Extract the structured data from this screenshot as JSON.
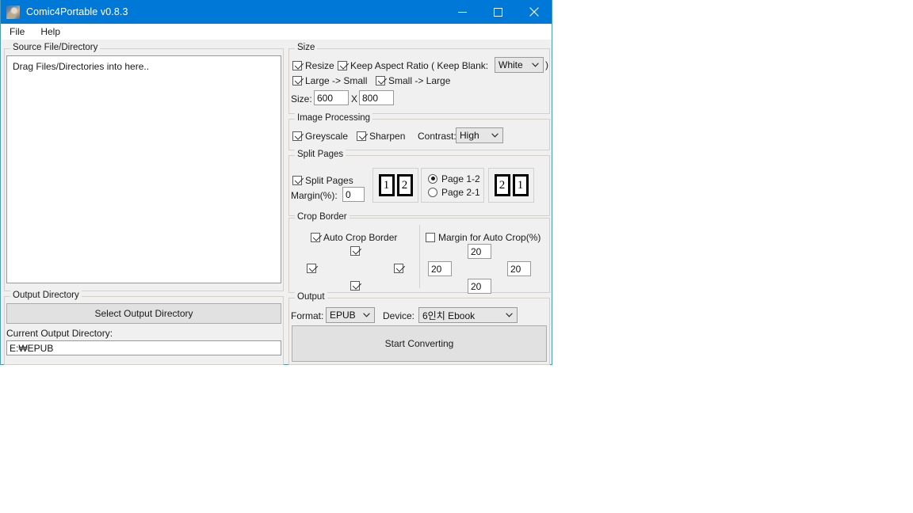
{
  "window": {
    "title": "Comic4Portable v0.8.3",
    "icon": "app-portrait-icon",
    "accent": "#0078d7",
    "minimize": "minimize-icon",
    "maximize": "maximize-icon",
    "close": "close-icon"
  },
  "menubar": {
    "items": [
      {
        "label": "File"
      },
      {
        "label": "Help"
      }
    ]
  },
  "source": {
    "legend": "Source File/Directory",
    "dropzone_text": "Drag Files/Directories into here.."
  },
  "output_directory": {
    "legend": "Output Directory",
    "select_button": "Select Output Directory",
    "current_label": "Current Output Directory:",
    "current_value": "E:₩EPUB"
  },
  "size": {
    "legend": "Size",
    "resize": {
      "label": "Resize",
      "checked": true
    },
    "keep_aspect": {
      "label": "Keep Aspect Ratio ( Keep Blank:",
      "checked": true
    },
    "keep_blank": {
      "value": "White",
      "close_paren": ")"
    },
    "large_to_small": {
      "label": "Large -> Small",
      "checked": true
    },
    "small_to_large": {
      "label": "Small -> Large",
      "checked": true
    },
    "size_label": "Size:",
    "width": "600",
    "x_label": "X",
    "height": "800"
  },
  "image_processing": {
    "legend": "Image Processing",
    "greyscale": {
      "label": "Greyscale",
      "checked": true
    },
    "sharpen": {
      "label": "Sharpen",
      "checked": true
    },
    "contrast_label": "Contrast:",
    "contrast_value": "High"
  },
  "split_pages": {
    "legend": "Split Pages",
    "enable": {
      "label": "Split Pages",
      "checked": true
    },
    "margin_label": "Margin(%):",
    "margin_value": "0",
    "order_left": {
      "first": "1",
      "second": "2"
    },
    "order_right": {
      "first": "2",
      "second": "1"
    },
    "page_1_2": {
      "label": "Page 1-2",
      "selected": true
    },
    "page_2_1": {
      "label": "Page 2-1",
      "selected": false
    }
  },
  "crop_border": {
    "legend": "Crop Border",
    "auto_crop": {
      "label": "Auto Crop Border",
      "checked": true
    },
    "top": {
      "checked": true
    },
    "left": {
      "checked": true
    },
    "right": {
      "checked": true
    },
    "bottom": {
      "checked": true
    },
    "margin_enable": {
      "label": "Margin for Auto Crop(%)",
      "checked": false
    },
    "margin_top": "20",
    "margin_left": "20",
    "margin_right": "20",
    "margin_bottom": "20"
  },
  "output": {
    "legend": "Output",
    "format_label": "Format:",
    "format_value": "EPUB",
    "device_label": "Device:",
    "device_value": "6인치 Ebook",
    "start_button": "Start Converting"
  }
}
